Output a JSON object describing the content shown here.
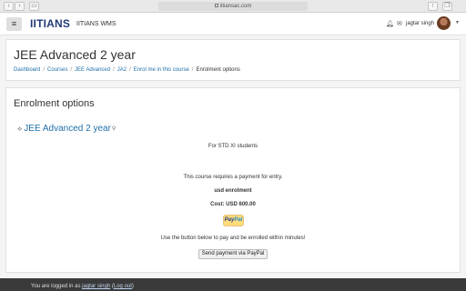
{
  "browser": {
    "url": "iitiansac.com"
  },
  "header": {
    "brand": "IITIANS",
    "site_name": "IITIANS WMS",
    "user_name": "jagtar singh"
  },
  "page": {
    "title": "JEE Advanced 2 year",
    "breadcrumb": [
      "Dashboard",
      "Courses",
      "JEE Advanced",
      "JA2",
      "Enrol me in this course",
      "Enrolment options"
    ]
  },
  "enrolment": {
    "heading": "Enrolment options",
    "course_name": "JEE Advanced 2 year",
    "summary": "For STD XI students",
    "payment_notice": "This course requires a payment for entry.",
    "method_name": "usd enrolment",
    "cost": "Cost: USD 600.00",
    "paypal_logo_pay": "Pay",
    "paypal_logo_pal": "Pal",
    "instruction": "Use the button below to pay and be enrolled within minutes!",
    "button_label": "Send payment via PayPal"
  },
  "footer": {
    "logged_in_prefix": "You are logged in as ",
    "user_link": "jagtar singh",
    "logout_open": " (",
    "logout_label": "Log out",
    "logout_close": ")"
  },
  "icons": {
    "hamburger": "hamburger-icon",
    "notifications": "bell-icon",
    "messages": "chat-icon",
    "course": "course-icon",
    "paypal": "paypal-logo"
  }
}
